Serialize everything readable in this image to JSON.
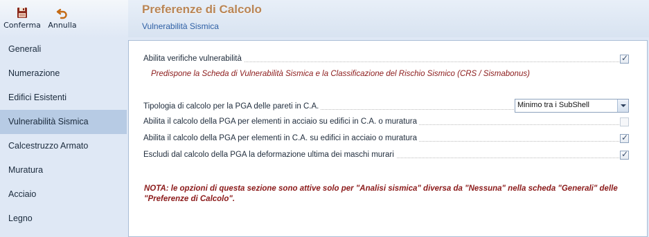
{
  "toolbar": {
    "confirm_label": "Conferma",
    "confirm_icon": "save-icon",
    "cancel_label": "Annulla",
    "cancel_icon": "undo-icon"
  },
  "nav": {
    "items": [
      {
        "label": "Generali",
        "active": false
      },
      {
        "label": "Numerazione",
        "active": false
      },
      {
        "label": "Edifici Esistenti",
        "active": false
      },
      {
        "label": "Vulnerabilità Sismica",
        "active": true
      },
      {
        "label": "Calcestruzzo Armato",
        "active": false
      },
      {
        "label": "Muratura",
        "active": false
      },
      {
        "label": "Acciaio",
        "active": false
      },
      {
        "label": "Legno",
        "active": false
      }
    ]
  },
  "header": {
    "title": "Preferenze di Calcolo",
    "subtitle": "Vulnerabilità Sismica"
  },
  "main": {
    "enable_vulnerability": {
      "label": "Abilita verifiche vulnerabilità",
      "checked": true,
      "description": "Predispone la Scheda di Vulnerabilità Sismica e la Classificazione del Rischio Sismico (CRS / Sismabonus)"
    },
    "pga_walls_type": {
      "label": "Tipologia di calcolo per la PGA delle pareti in C.A.",
      "value": "Minimo tra i SubShell"
    },
    "pga_steel": {
      "label": "Abilita il calcolo della PGA per elementi in acciaio su edifici in C.A. o muratura",
      "checked": false,
      "enabled": false
    },
    "pga_ca": {
      "label": "Abilita il calcolo della PGA per elementi in C.A. su edifici in acciaio o muratura",
      "checked": true
    },
    "exclude_deformation": {
      "label": "Escludi dal calcolo della PGA la deformazione ultima dei maschi murari",
      "checked": true
    },
    "note": "NOTA: le opzioni di questa sezione sono attive solo per \"Analisi sismica\" diversa da \"Nessuna\" nella scheda \"Generali\" delle \"Preferenze di Calcolo\"."
  },
  "colors": {
    "title": "#b98555",
    "subtitle": "#2d5fa4",
    "note": "#8b1a1a",
    "nav_active": "#b7cbe4"
  }
}
